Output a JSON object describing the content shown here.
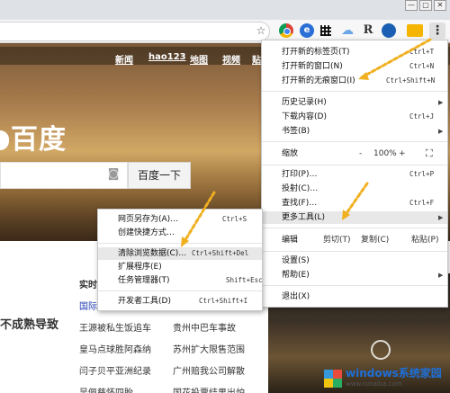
{
  "window": {
    "restore_label": "▢",
    "close_label": "✕",
    "min_label": "—"
  },
  "toolbar": {
    "star_icon": "star-icon",
    "ext_blue_label": "e",
    "ext_r_label": "R",
    "menu_label": "⋮"
  },
  "page": {
    "nav": [
      "新闻",
      "hao123",
      "地图",
      "视频",
      "贴"
    ],
    "logo_text": "百度",
    "search_button": "百度一下",
    "news_heading": "实时",
    "slogan": "不成熟导致",
    "news_left": [
      "国际",
      "王源被私生饭追车",
      "皇马点球胜阿森纳",
      "闫子贝平亚洲纪录",
      "吴佩慈怀四胎"
    ],
    "news_right": [
      "贵州中巴车事故",
      "苏州扩大限售范围",
      "广州赔我公司解散",
      "国花投票结果出炉"
    ]
  },
  "main_menu": {
    "items": [
      {
        "label": "打开新的标签页(T)",
        "shortcut": "Ctrl+T"
      },
      {
        "label": "打开新的窗口(N)",
        "shortcut": "Ctrl+N"
      },
      {
        "label": "打开新的无痕窗口(I)",
        "shortcut": "Ctrl+Shift+N"
      },
      {
        "label": "历史记录(H)",
        "shortcut": ""
      },
      {
        "label": "下载内容(D)",
        "shortcut": "Ctrl+J"
      },
      {
        "label": "书签(B)",
        "shortcut": ""
      },
      {
        "label": "缩放",
        "shortcut": ""
      },
      {
        "label": "打印(P)…",
        "shortcut": "Ctrl+P"
      },
      {
        "label": "投射(C)…",
        "shortcut": ""
      },
      {
        "label": "查找(F)…",
        "shortcut": "Ctrl+F"
      },
      {
        "label": "更多工具(L)",
        "shortcut": ""
      },
      {
        "label": "编辑",
        "shortcut": ""
      },
      {
        "label": "设置(S)",
        "shortcut": ""
      },
      {
        "label": "帮助(E)",
        "shortcut": ""
      },
      {
        "label": "退出(X)",
        "shortcut": ""
      }
    ],
    "zoom": {
      "minus": "-",
      "value": "100%",
      "plus": "+",
      "fullscreen": "⛶"
    },
    "edit": {
      "cut": "剪切(T)",
      "copy": "复制(C)",
      "paste": "粘贴(P)"
    }
  },
  "sub_menu": {
    "items": [
      {
        "label": "网页另存为(A)…",
        "shortcut": "Ctrl+S"
      },
      {
        "label": "创建快捷方式…",
        "shortcut": ""
      },
      {
        "label": "清除浏览数据(C)…",
        "shortcut": "Ctrl+Shift+Del"
      },
      {
        "label": "扩展程序(E)",
        "shortcut": ""
      },
      {
        "label": "任务管理器(T)",
        "shortcut": "Shift+Esc"
      },
      {
        "label": "开发者工具(D)",
        "shortcut": "Ctrl+Shift+I"
      }
    ]
  },
  "watermark": {
    "title": "windows系统家园",
    "sub": "www.runaiba.com"
  },
  "colors": {
    "arrow": "#f0b020",
    "highlight": "#e8e8e8"
  }
}
